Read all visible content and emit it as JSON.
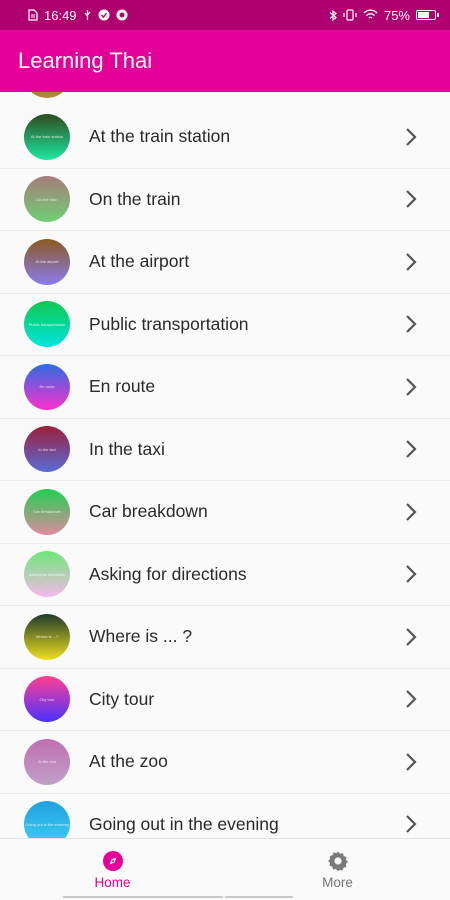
{
  "status_bar": {
    "time": "16:49",
    "battery_text": "75%",
    "battery_level": 0.75,
    "left_icons": [
      "document-icon",
      "usb-icon",
      "check-icon",
      "message-icon"
    ],
    "right_icons": [
      "bluetooth-icon",
      "vibrate-icon",
      "wifi-icon",
      "battery-icon"
    ]
  },
  "app_bar": {
    "title": "Learning Thai"
  },
  "lessons": [
    {
      "label": "At the train station",
      "thumb_text": "At the train station",
      "gradient": [
        "#2e4a1f",
        "#1de9a0"
      ]
    },
    {
      "label": "On the train",
      "thumb_text": "On the train",
      "gradient": [
        "#a87c7c",
        "#6fcf74"
      ]
    },
    {
      "label": "At the airport",
      "thumb_text": "At the airport",
      "gradient": [
        "#8b5a1f",
        "#8a7cf0"
      ]
    },
    {
      "label": "Public transportation",
      "thumb_text": "Public transportation",
      "gradient": [
        "#10c850",
        "#00e5e0"
      ]
    },
    {
      "label": "En route",
      "thumb_text": "En route",
      "gradient": [
        "#2a6ee0",
        "#ff2fcf"
      ]
    },
    {
      "label": "In the taxi",
      "thumb_text": "In the taxi",
      "gradient": [
        "#9c1f3a",
        "#5a6cd8"
      ]
    },
    {
      "label": "Car breakdown",
      "thumb_text": "Car breakdown",
      "gradient": [
        "#1fd050",
        "#e08aa0"
      ]
    },
    {
      "label": "Asking for directions",
      "thumb_text": "Asking for directions",
      "gradient": [
        "#6ee87a",
        "#f5b8ea"
      ]
    },
    {
      "label": "Where is ... ?",
      "thumb_text": "Where is ...?",
      "gradient": [
        "#1f3a2a",
        "#f0e020"
      ]
    },
    {
      "label": "City tour",
      "thumb_text": "City tour",
      "gradient": [
        "#ff4090",
        "#4a30ff"
      ]
    },
    {
      "label": "At the zoo",
      "thumb_text": "At the zoo",
      "gradient": [
        "#c070b0",
        "#c0a0c8"
      ]
    },
    {
      "label": "Going out in the evening",
      "thumb_text": "Going out in the evening",
      "gradient": [
        "#20a0e0",
        "#40d0f0"
      ]
    }
  ],
  "bottom_nav": {
    "home_label": "Home",
    "more_label": "More"
  },
  "colors": {
    "status_bar": "#b0006f",
    "app_bar": "#e6009a",
    "accent": "#e6009a"
  }
}
